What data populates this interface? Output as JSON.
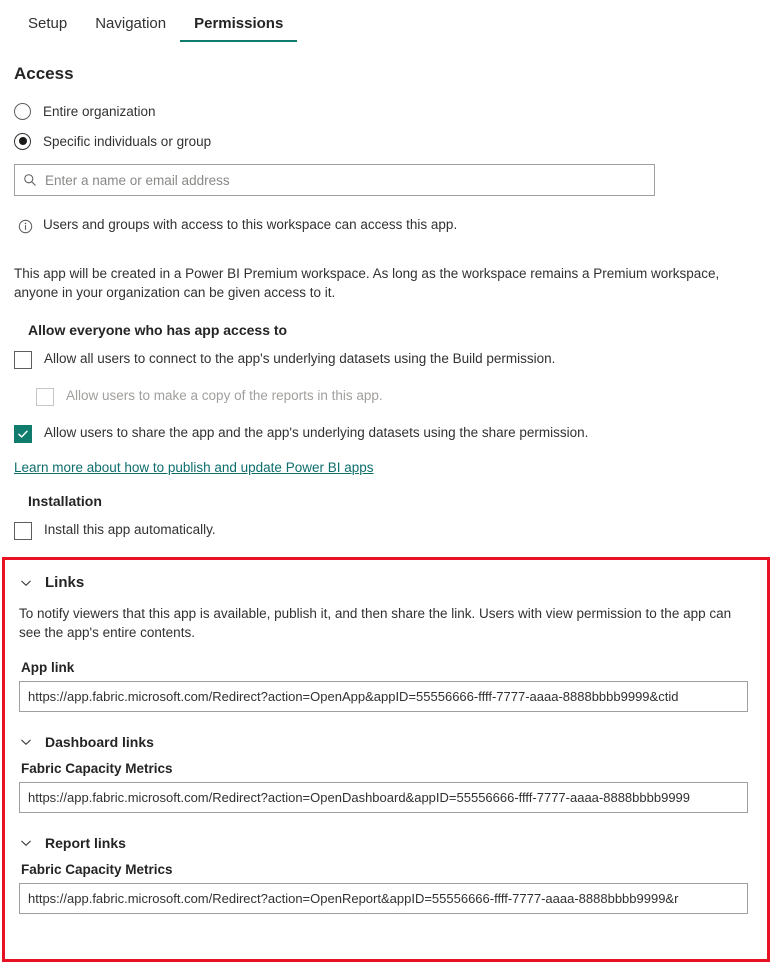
{
  "tabs": [
    {
      "label": "Setup",
      "active": false
    },
    {
      "label": "Navigation",
      "active": false
    },
    {
      "label": "Permissions",
      "active": true
    }
  ],
  "access": {
    "heading": "Access",
    "options": [
      {
        "label": "Entire organization",
        "selected": false
      },
      {
        "label": "Specific individuals or group",
        "selected": true
      }
    ],
    "search_placeholder": "Enter a name or email address",
    "search_value": "",
    "info_message": "Users and groups with access to this workspace can access this app.",
    "premium_note": "This app will be created in a Power BI Premium workspace. As long as the workspace remains a Premium workspace, anyone in your organization can be given access to it."
  },
  "allow_section": {
    "heading": "Allow everyone who has app access to",
    "checkboxes": [
      {
        "label": "Allow all users to connect to the app's underlying datasets using the Build permission.",
        "checked": false,
        "disabled": false,
        "indented": false
      },
      {
        "label": "Allow users to make a copy of the reports in this app.",
        "checked": false,
        "disabled": true,
        "indented": true
      },
      {
        "label": "Allow users to share the app and the app's underlying datasets using the share permission.",
        "checked": true,
        "disabled": false,
        "indented": false
      }
    ],
    "learn_more_link": "Learn more about how to publish and update Power BI apps"
  },
  "installation": {
    "heading": "Installation",
    "checkbox_label": "Install this app automatically.",
    "checked": false
  },
  "links_section": {
    "title": "Links",
    "description": "To notify viewers that this app is available, publish it, and then share the link. Users with view permission to the app can see the app's entire contents.",
    "app_link_label": "App link",
    "app_link_url": "https://app.fabric.microsoft.com/Redirect?action=OpenApp&appID=55556666-ffff-7777-aaaa-8888bbbb9999&ctid",
    "dashboard_links_title": "Dashboard links",
    "dashboard_item_label": "Fabric Capacity Metrics",
    "dashboard_item_url": "https://app.fabric.microsoft.com/Redirect?action=OpenDashboard&appID=55556666-ffff-7777-aaaa-8888bbbb9999",
    "report_links_title": "Report links",
    "report_item_label": "Fabric Capacity Metrics",
    "report_item_url": "https://app.fabric.microsoft.com/Redirect?action=OpenReport&appID=55556666-ffff-7777-aaaa-8888bbbb9999&r"
  },
  "colors": {
    "accent_teal": "#0e7c6b",
    "checkbox_checked": "#107c6e",
    "highlight_red": "#e81123",
    "link": "#0e6e6e"
  }
}
